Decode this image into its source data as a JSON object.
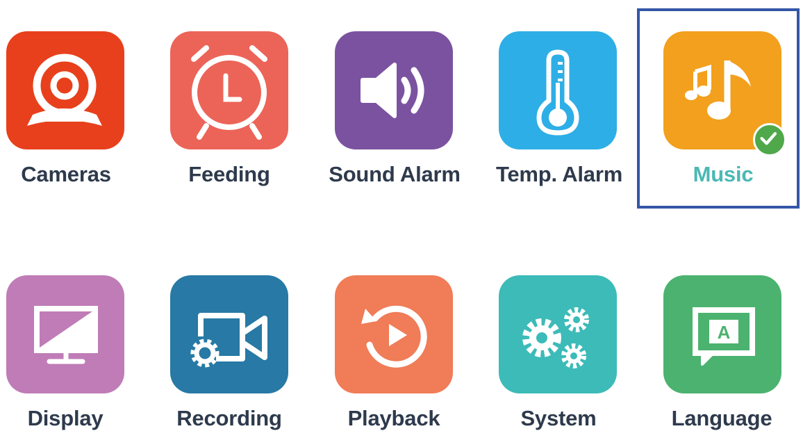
{
  "menu": {
    "selected": "Music",
    "items": [
      {
        "label": "Cameras",
        "icon": "camera-icon",
        "color": "#e8401c"
      },
      {
        "label": "Feeding",
        "icon": "alarm-clock-icon",
        "color": "#ec6458"
      },
      {
        "label": "Sound Alarm",
        "icon": "speaker-icon",
        "color": "#7b52a0"
      },
      {
        "label": "Temp. Alarm",
        "icon": "thermometer-icon",
        "color": "#2eaee6"
      },
      {
        "label": "Music",
        "icon": "music-note-icon",
        "color": "#f2a01d"
      },
      {
        "label": "Display",
        "icon": "monitor-icon",
        "color": "#bf7cb7"
      },
      {
        "label": "Recording",
        "icon": "video-record-icon",
        "color": "#2879a5"
      },
      {
        "label": "Playback",
        "icon": "replay-icon",
        "color": "#f07c58"
      },
      {
        "label": "System",
        "icon": "gears-icon",
        "color": "#3cbbb8"
      },
      {
        "label": "Language",
        "icon": "language-icon",
        "color": "#4bb36f"
      }
    ]
  },
  "colors": {
    "label_text": "#2e3a4c",
    "selected_label": "#4bb8b5",
    "selection_frame": "#3456a6",
    "check_badge": "#4fa84a"
  },
  "language_glyph": "A"
}
